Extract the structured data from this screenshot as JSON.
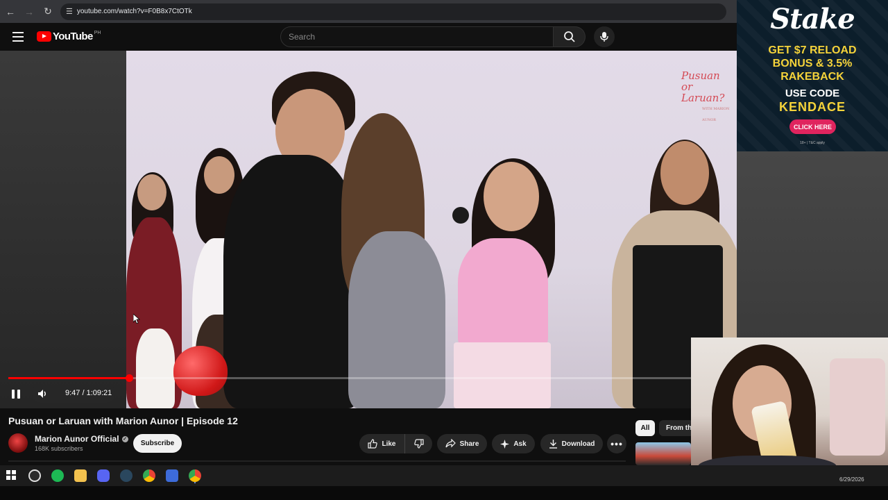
{
  "browser": {
    "url": "youtube.com/watch?v=F0B8x7CtOTk"
  },
  "header": {
    "logo_text": "YouTube",
    "country": "PH",
    "search_placeholder": "Search"
  },
  "video": {
    "show_logo_line1": "Pusuan",
    "show_logo_line2": "or",
    "show_logo_line3": "Laruan?",
    "show_logo_sub": "WITH MARION AUNOR",
    "progress_fraction": 0.146,
    "time_display": "9:47 / 1:09:21",
    "title": "Pusuan or Laruan with Marion Aunor | Episode 12"
  },
  "channel": {
    "name": "Marion Aunor Official",
    "subscribers": "168K subscribers",
    "subscribe_label": "Subscribe"
  },
  "actions": {
    "like": "Like",
    "share": "Share",
    "ask": "Ask",
    "download": "Download"
  },
  "chips": {
    "all": "All",
    "from": "From th"
  },
  "ad": {
    "brand": "Stake",
    "headline_1": "GET $7 RELOAD",
    "headline_2": "BONUS & 3.5%",
    "headline_3": "RAKEBACK",
    "use_code": "USE CODE",
    "code": "KENDACE",
    "cta": "CLICK HERE",
    "terms": "18+ | T&C apply"
  },
  "taskbar": {
    "clock": "6/29/2026",
    "icons": [
      "windows-icon",
      "obs-icon",
      "spotify-icon",
      "file-explorer-icon",
      "discord-icon",
      "steam-icon",
      "chrome-icon",
      "app-icon",
      "chrome-active-icon"
    ]
  },
  "colors": {
    "accent_red": "#ff0000",
    "stake_yellow": "#f5d33a",
    "stake_cta": "#e0245e"
  }
}
